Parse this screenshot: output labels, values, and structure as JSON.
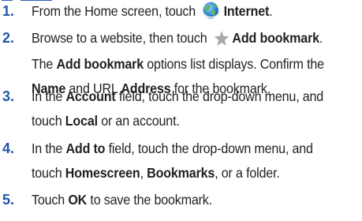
{
  "steps": [
    {
      "num": "1.",
      "lines": [
        {
          "pre": "From the Home screen, touch ",
          "icon": "globe-icon",
          "bold": "Internet",
          "post": "."
        }
      ]
    },
    {
      "num": "2.",
      "lines": [
        {
          "pre": "Browse to a website, then touch ",
          "icon": "star-icon",
          "bold": "Add bookmark",
          "post": "."
        },
        {
          "pre": "The ",
          "bold": "Add bookmark",
          "post": " options list displays. Confirm the"
        },
        {
          "bold": "Name",
          "mid": " and URL ",
          "bold2": "Address",
          "post": " for the bookmark."
        }
      ]
    },
    {
      "num": "3.",
      "lines": [
        {
          "pre": "In the ",
          "bold": "Account",
          "post": " field, touch the drop-down menu, and"
        },
        {
          "pre": "touch ",
          "bold": "Local",
          "post": " or an account."
        }
      ]
    },
    {
      "num": "4.",
      "lines": [
        {
          "pre": "In the ",
          "bold": "Add to",
          "post": " field, touch the drop-down menu, and"
        },
        {
          "pre": "touch ",
          "bold": "Homescreen",
          "mid": ", ",
          "bold2": "Bookmarks",
          "post": ", or a folder."
        }
      ]
    },
    {
      "num": "5.",
      "lines": [
        {
          "pre": "Touch ",
          "bold": "OK",
          "post": " to save the bookmark."
        }
      ]
    }
  ],
  "colors": {
    "number": "#1f57a8",
    "text": "#231f20",
    "star": "#a9a9ab"
  }
}
